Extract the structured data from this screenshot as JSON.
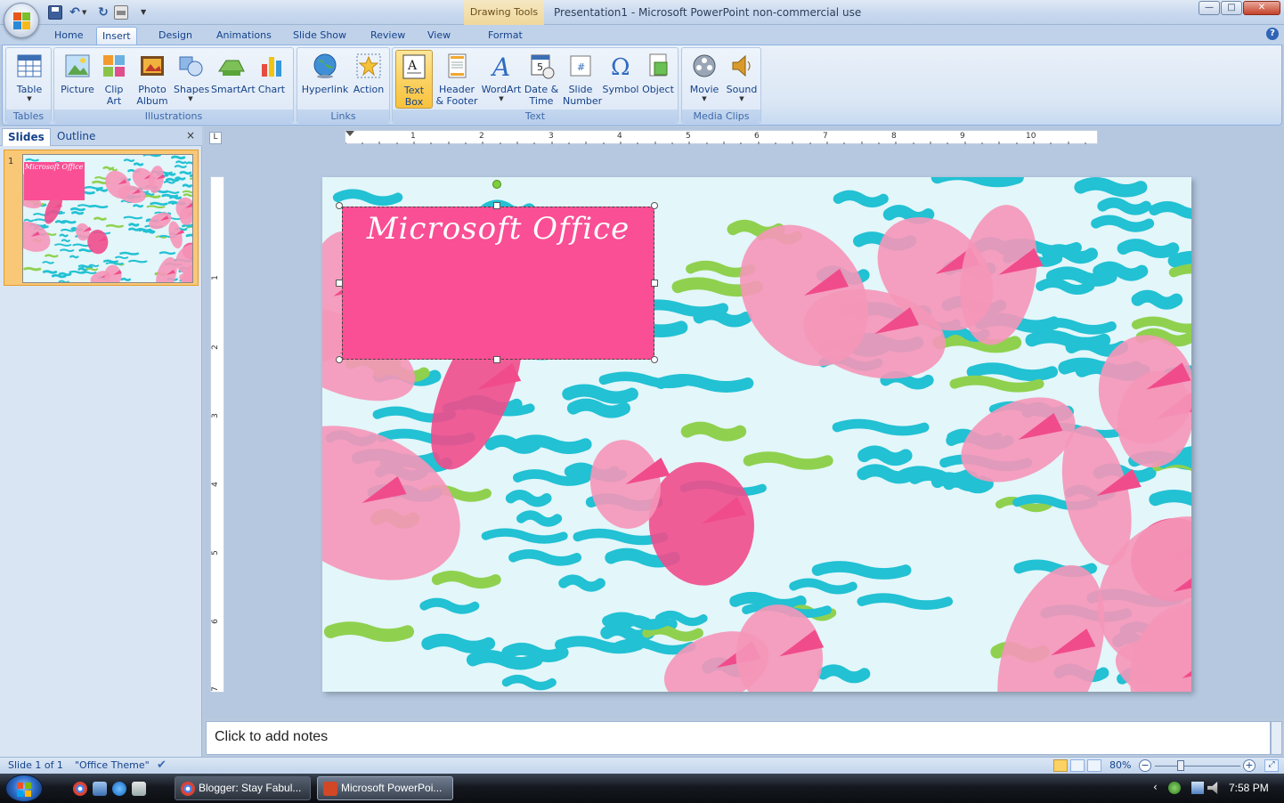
{
  "window": {
    "contextual_tab": "Drawing Tools",
    "title": "Presentation1 - Microsoft PowerPoint non-commercial use",
    "minimize": "—",
    "maximize": "□",
    "close": "✕"
  },
  "ribbon_tabs": [
    "Home",
    "Insert",
    "Design",
    "Animations",
    "Slide Show",
    "Review",
    "View",
    "Format"
  ],
  "active_tab": "Insert",
  "help": "?",
  "groups": {
    "tables": {
      "label": "Tables",
      "buttons": [
        {
          "label": "Table",
          "icon": "table-icon"
        }
      ]
    },
    "illustrations": {
      "label": "Illustrations",
      "buttons": [
        {
          "label": "Picture",
          "icon": "picture-icon"
        },
        {
          "label": "Clip Art",
          "icon": "clip-art-icon"
        },
        {
          "label": "Photo Album",
          "icon": "photo-album-icon"
        },
        {
          "label": "Shapes",
          "icon": "shapes-icon"
        },
        {
          "label": "SmartArt",
          "icon": "smartart-icon"
        },
        {
          "label": "Chart",
          "icon": "chart-icon"
        }
      ]
    },
    "links": {
      "label": "Links",
      "buttons": [
        {
          "label": "Hyperlink",
          "icon": "globe-icon"
        },
        {
          "label": "Action",
          "icon": "action-star-icon"
        }
      ]
    },
    "text": {
      "label": "Text",
      "buttons": [
        {
          "label": "Text Box",
          "icon": "text-box-icon"
        },
        {
          "label": "Header & Footer",
          "icon": "header-footer-icon"
        },
        {
          "label": "WordArt",
          "icon": "wordart-icon"
        },
        {
          "label": "Date & Time",
          "icon": "date-time-icon"
        },
        {
          "label": "Slide Number",
          "icon": "slide-number-icon"
        },
        {
          "label": "Symbol",
          "icon": "omega-icon"
        },
        {
          "label": "Object",
          "icon": "object-icon"
        }
      ]
    },
    "media_clips": {
      "label": "Media Clips",
      "buttons": [
        {
          "label": "Movie",
          "icon": "film-reel-icon"
        },
        {
          "label": "Sound",
          "icon": "speaker-icon"
        }
      ]
    }
  },
  "slides_pane": {
    "tab_slides": "Slides",
    "tab_outline": "Outline",
    "close": "×",
    "thumbnail_number": "1",
    "thumbnail_title": "Microsoft Office"
  },
  "rulers": {
    "horizontal": [
      "1",
      "2",
      "3",
      "4",
      "5",
      "6",
      "7",
      "8",
      "9",
      "10"
    ],
    "vertical": [
      "1",
      "2",
      "3",
      "4",
      "5",
      "6",
      "7"
    ]
  },
  "slide": {
    "title_text": "Microsoft Office",
    "box_color": "#fa4f95",
    "background_colors": [
      "#22c1d3",
      "#f04c8c",
      "#f596b8",
      "#8fd14f",
      "#e3f6fa"
    ]
  },
  "notes": {
    "placeholder": "Click to add notes"
  },
  "status": {
    "slide_info": "Slide 1 of 1",
    "theme": "\"Office Theme\"",
    "zoom": "80%",
    "zoom_level": 0.3
  },
  "taskbar": {
    "items": [
      {
        "label": "Blogger: Stay Fabul...",
        "icon": "chrome-icon"
      },
      {
        "label": "Microsoft PowerPoi...",
        "icon": "powerpoint-icon"
      }
    ],
    "clock": "7:58 PM"
  }
}
